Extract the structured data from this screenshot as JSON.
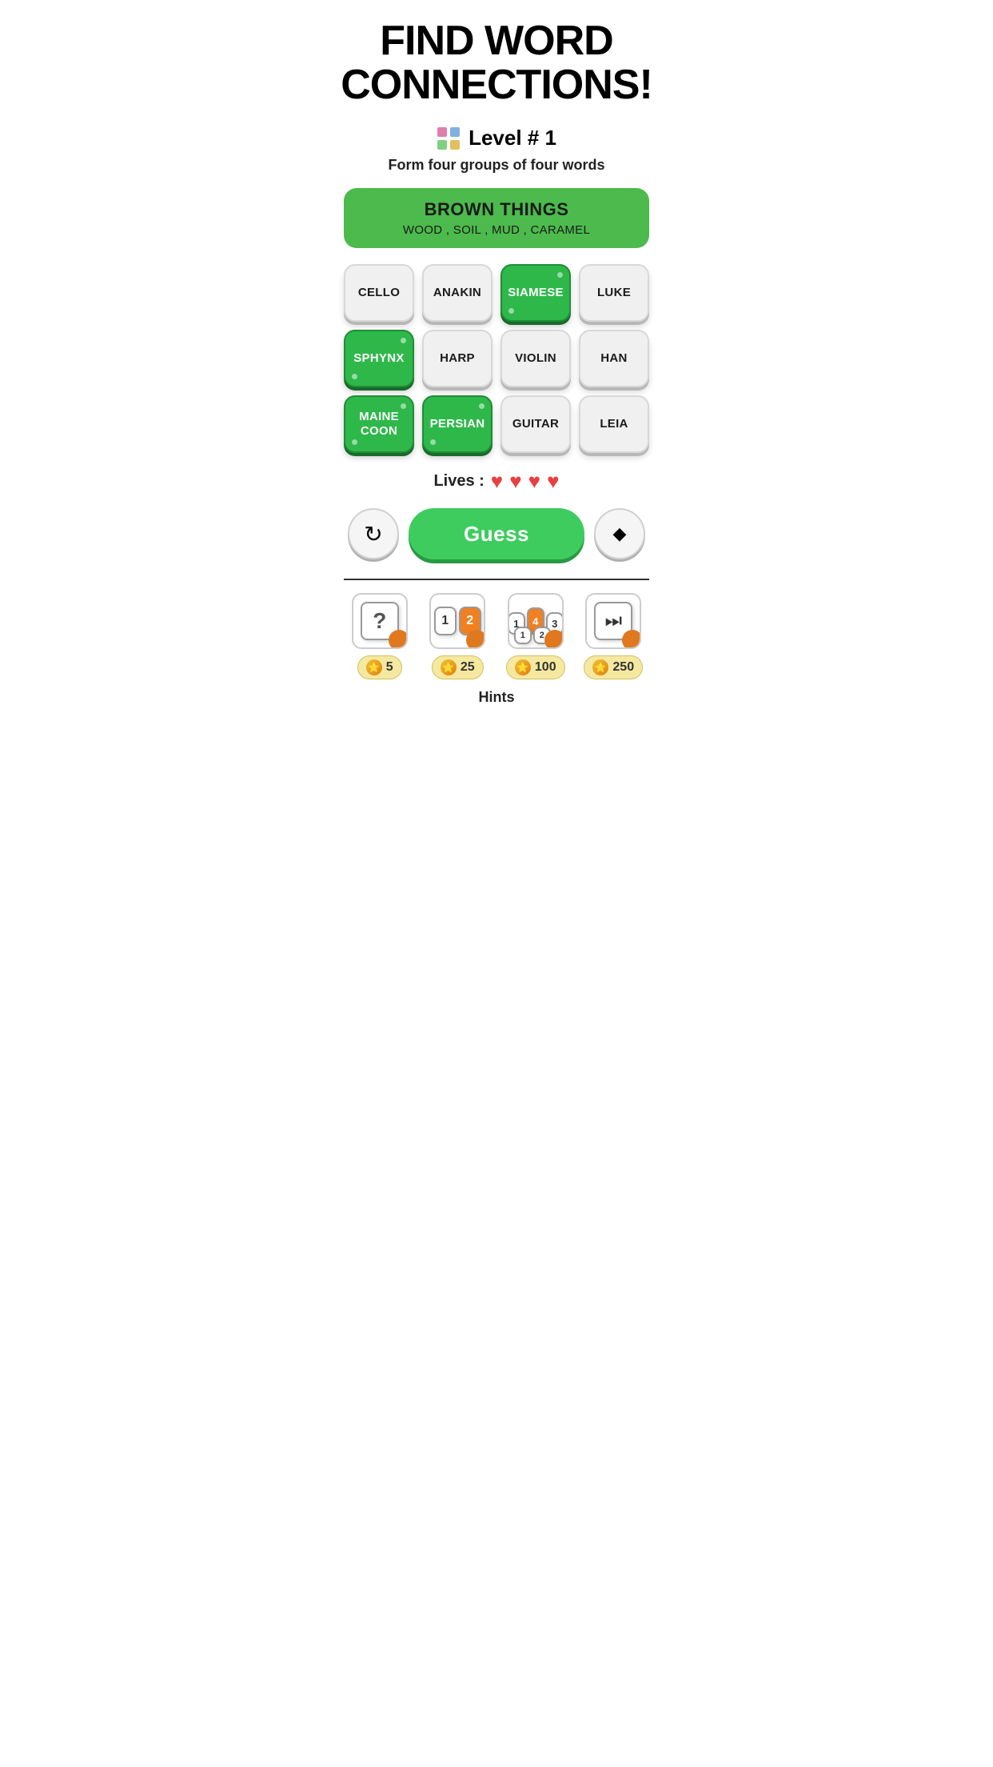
{
  "header": {
    "title": "FIND WORD\nCONNECTIONS!"
  },
  "level": {
    "icon_label": "grid-icon",
    "text": "Level # 1"
  },
  "subtitle": "Form four groups of four words",
  "revealed_group": {
    "title": "BROWN THINGS",
    "words": "WOOD , SOIL , MUD , CARAMEL"
  },
  "tiles": [
    {
      "word": "CELLO",
      "selected": false,
      "multiline": false
    },
    {
      "word": "ANAKIN",
      "selected": false,
      "multiline": false
    },
    {
      "word": "SIAMESE",
      "selected": true,
      "multiline": false
    },
    {
      "word": "LUKE",
      "selected": false,
      "multiline": false
    },
    {
      "word": "SPHYNX",
      "selected": true,
      "multiline": false
    },
    {
      "word": "HARP",
      "selected": false,
      "multiline": false
    },
    {
      "word": "VIOLIN",
      "selected": false,
      "multiline": false
    },
    {
      "word": "HAN",
      "selected": false,
      "multiline": false
    },
    {
      "word": "MAINE\nCOON",
      "selected": true,
      "multiline": true
    },
    {
      "word": "PERSIAN",
      "selected": true,
      "multiline": false
    },
    {
      "word": "GUITAR",
      "selected": false,
      "multiline": false
    },
    {
      "word": "LEIA",
      "selected": false,
      "multiline": false
    }
  ],
  "lives": {
    "label": "Lives :",
    "count": 4
  },
  "buttons": {
    "shuffle": "↻",
    "guess": "Guess",
    "erase": "◆"
  },
  "hints": [
    {
      "type": "question",
      "cost": 5
    },
    {
      "type": "swap12",
      "cost": 25
    },
    {
      "type": "swap123",
      "cost": 100
    },
    {
      "type": "play",
      "cost": 250
    }
  ],
  "hints_label": "Hints"
}
